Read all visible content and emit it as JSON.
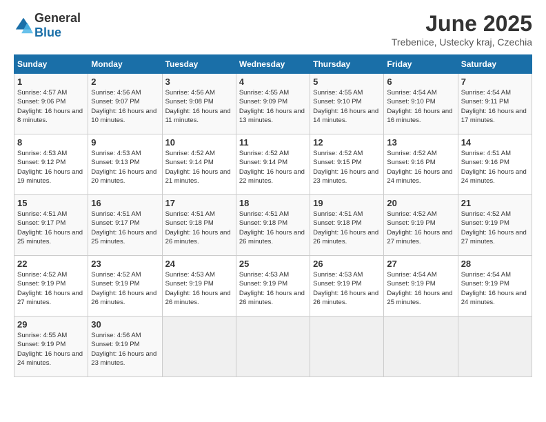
{
  "header": {
    "logo": {
      "general": "General",
      "blue": "Blue"
    },
    "title": "June 2025",
    "subtitle": "Trebenice, Ustecky kraj, Czechia"
  },
  "calendar": {
    "days_of_week": [
      "Sunday",
      "Monday",
      "Tuesday",
      "Wednesday",
      "Thursday",
      "Friday",
      "Saturday"
    ],
    "weeks": [
      [
        null,
        {
          "day": "2",
          "sunrise": "Sunrise: 4:56 AM",
          "sunset": "Sunset: 9:07 PM",
          "daylight": "Daylight: 16 hours and 10 minutes."
        },
        {
          "day": "3",
          "sunrise": "Sunrise: 4:56 AM",
          "sunset": "Sunset: 9:08 PM",
          "daylight": "Daylight: 16 hours and 11 minutes."
        },
        {
          "day": "4",
          "sunrise": "Sunrise: 4:55 AM",
          "sunset": "Sunset: 9:09 PM",
          "daylight": "Daylight: 16 hours and 13 minutes."
        },
        {
          "day": "5",
          "sunrise": "Sunrise: 4:55 AM",
          "sunset": "Sunset: 9:10 PM",
          "daylight": "Daylight: 16 hours and 14 minutes."
        },
        {
          "day": "6",
          "sunrise": "Sunrise: 4:54 AM",
          "sunset": "Sunset: 9:10 PM",
          "daylight": "Daylight: 16 hours and 16 minutes."
        },
        {
          "day": "7",
          "sunrise": "Sunrise: 4:54 AM",
          "sunset": "Sunset: 9:11 PM",
          "daylight": "Daylight: 16 hours and 17 minutes."
        }
      ],
      [
        {
          "day": "1",
          "sunrise": "Sunrise: 4:57 AM",
          "sunset": "Sunset: 9:06 PM",
          "daylight": "Daylight: 16 hours and 8 minutes."
        },
        null,
        null,
        null,
        null,
        null,
        null
      ],
      [
        {
          "day": "8",
          "sunrise": "Sunrise: 4:53 AM",
          "sunset": "Sunset: 9:12 PM",
          "daylight": "Daylight: 16 hours and 19 minutes."
        },
        {
          "day": "9",
          "sunrise": "Sunrise: 4:53 AM",
          "sunset": "Sunset: 9:13 PM",
          "daylight": "Daylight: 16 hours and 20 minutes."
        },
        {
          "day": "10",
          "sunrise": "Sunrise: 4:52 AM",
          "sunset": "Sunset: 9:14 PM",
          "daylight": "Daylight: 16 hours and 21 minutes."
        },
        {
          "day": "11",
          "sunrise": "Sunrise: 4:52 AM",
          "sunset": "Sunset: 9:14 PM",
          "daylight": "Daylight: 16 hours and 22 minutes."
        },
        {
          "day": "12",
          "sunrise": "Sunrise: 4:52 AM",
          "sunset": "Sunset: 9:15 PM",
          "daylight": "Daylight: 16 hours and 23 minutes."
        },
        {
          "day": "13",
          "sunrise": "Sunrise: 4:52 AM",
          "sunset": "Sunset: 9:16 PM",
          "daylight": "Daylight: 16 hours and 24 minutes."
        },
        {
          "day": "14",
          "sunrise": "Sunrise: 4:51 AM",
          "sunset": "Sunset: 9:16 PM",
          "daylight": "Daylight: 16 hours and 24 minutes."
        }
      ],
      [
        {
          "day": "15",
          "sunrise": "Sunrise: 4:51 AM",
          "sunset": "Sunset: 9:17 PM",
          "daylight": "Daylight: 16 hours and 25 minutes."
        },
        {
          "day": "16",
          "sunrise": "Sunrise: 4:51 AM",
          "sunset": "Sunset: 9:17 PM",
          "daylight": "Daylight: 16 hours and 25 minutes."
        },
        {
          "day": "17",
          "sunrise": "Sunrise: 4:51 AM",
          "sunset": "Sunset: 9:18 PM",
          "daylight": "Daylight: 16 hours and 26 minutes."
        },
        {
          "day": "18",
          "sunrise": "Sunrise: 4:51 AM",
          "sunset": "Sunset: 9:18 PM",
          "daylight": "Daylight: 16 hours and 26 minutes."
        },
        {
          "day": "19",
          "sunrise": "Sunrise: 4:51 AM",
          "sunset": "Sunset: 9:18 PM",
          "daylight": "Daylight: 16 hours and 26 minutes."
        },
        {
          "day": "20",
          "sunrise": "Sunrise: 4:52 AM",
          "sunset": "Sunset: 9:19 PM",
          "daylight": "Daylight: 16 hours and 27 minutes."
        },
        {
          "day": "21",
          "sunrise": "Sunrise: 4:52 AM",
          "sunset": "Sunset: 9:19 PM",
          "daylight": "Daylight: 16 hours and 27 minutes."
        }
      ],
      [
        {
          "day": "22",
          "sunrise": "Sunrise: 4:52 AM",
          "sunset": "Sunset: 9:19 PM",
          "daylight": "Daylight: 16 hours and 27 minutes."
        },
        {
          "day": "23",
          "sunrise": "Sunrise: 4:52 AM",
          "sunset": "Sunset: 9:19 PM",
          "daylight": "Daylight: 16 hours and 26 minutes."
        },
        {
          "day": "24",
          "sunrise": "Sunrise: 4:53 AM",
          "sunset": "Sunset: 9:19 PM",
          "daylight": "Daylight: 16 hours and 26 minutes."
        },
        {
          "day": "25",
          "sunrise": "Sunrise: 4:53 AM",
          "sunset": "Sunset: 9:19 PM",
          "daylight": "Daylight: 16 hours and 26 minutes."
        },
        {
          "day": "26",
          "sunrise": "Sunrise: 4:53 AM",
          "sunset": "Sunset: 9:19 PM",
          "daylight": "Daylight: 16 hours and 26 minutes."
        },
        {
          "day": "27",
          "sunrise": "Sunrise: 4:54 AM",
          "sunset": "Sunset: 9:19 PM",
          "daylight": "Daylight: 16 hours and 25 minutes."
        },
        {
          "day": "28",
          "sunrise": "Sunrise: 4:54 AM",
          "sunset": "Sunset: 9:19 PM",
          "daylight": "Daylight: 16 hours and 24 minutes."
        }
      ],
      [
        {
          "day": "29",
          "sunrise": "Sunrise: 4:55 AM",
          "sunset": "Sunset: 9:19 PM",
          "daylight": "Daylight: 16 hours and 24 minutes."
        },
        {
          "day": "30",
          "sunrise": "Sunrise: 4:56 AM",
          "sunset": "Sunset: 9:19 PM",
          "daylight": "Daylight: 16 hours and 23 minutes."
        },
        null,
        null,
        null,
        null,
        null
      ]
    ]
  }
}
